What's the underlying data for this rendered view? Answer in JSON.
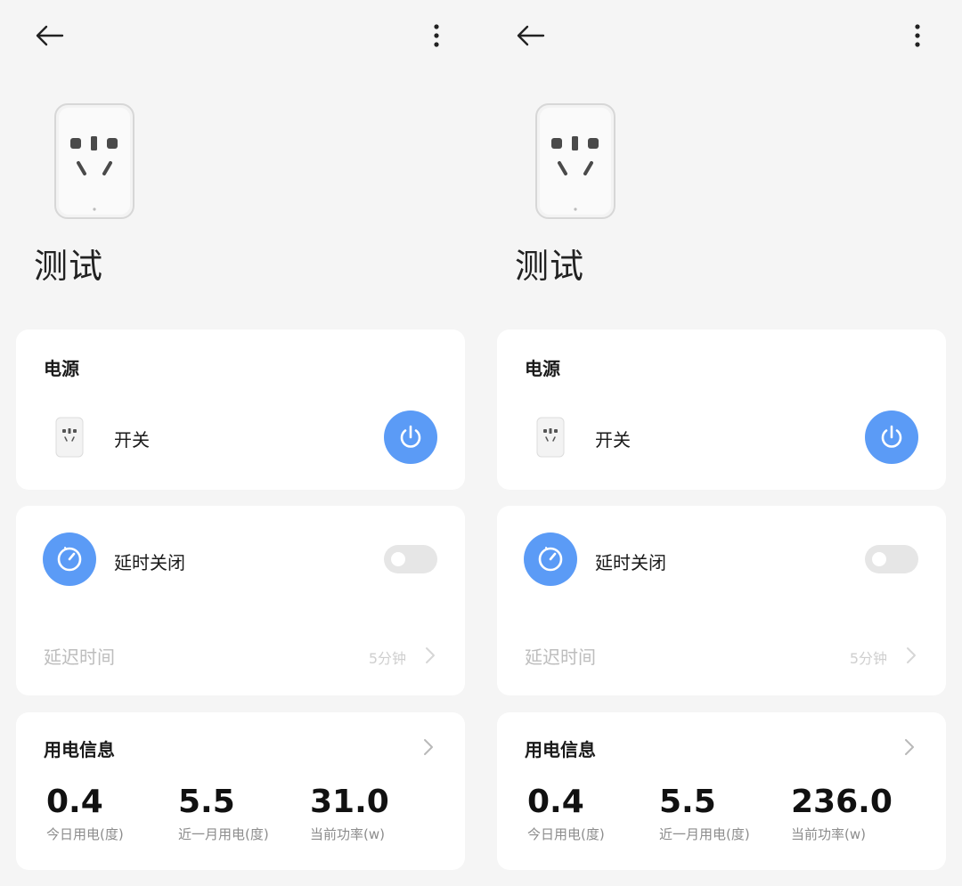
{
  "panels": [
    {
      "device_name": "测试",
      "power_card": {
        "title": "电源",
        "switch_label": "开关"
      },
      "delay_card": {
        "label": "延时关闭",
        "toggle_on": false,
        "delay_time_label": "延迟时间",
        "delay_time_value": "5分钟"
      },
      "usage_card": {
        "title": "用电信息",
        "stats": [
          {
            "value": "0.4",
            "label": "今日用电(度)"
          },
          {
            "value": "5.5",
            "label": "近一月用电(度)"
          },
          {
            "value": "31.0",
            "label": "当前功率(w)"
          }
        ]
      }
    },
    {
      "device_name": "测试",
      "power_card": {
        "title": "电源",
        "switch_label": "开关"
      },
      "delay_card": {
        "label": "延时关闭",
        "toggle_on": false,
        "delay_time_label": "延迟时间",
        "delay_time_value": "5分钟"
      },
      "usage_card": {
        "title": "用电信息",
        "stats": [
          {
            "value": "0.4",
            "label": "今日用电(度)"
          },
          {
            "value": "5.5",
            "label": "近一月用电(度)"
          },
          {
            "value": "236.0",
            "label": "当前功率(w)"
          }
        ]
      }
    }
  ],
  "icons": {
    "back": "arrow-left-icon",
    "more": "more-vertical-icon",
    "power": "power-icon",
    "timer": "timer-icon",
    "chevron": "chevron-right-icon",
    "device": "socket-icon"
  },
  "colors": {
    "accent": "#5b9bf6",
    "background": "#f5f5f5",
    "card": "#ffffff",
    "muted_text": "#bdbdbd"
  }
}
